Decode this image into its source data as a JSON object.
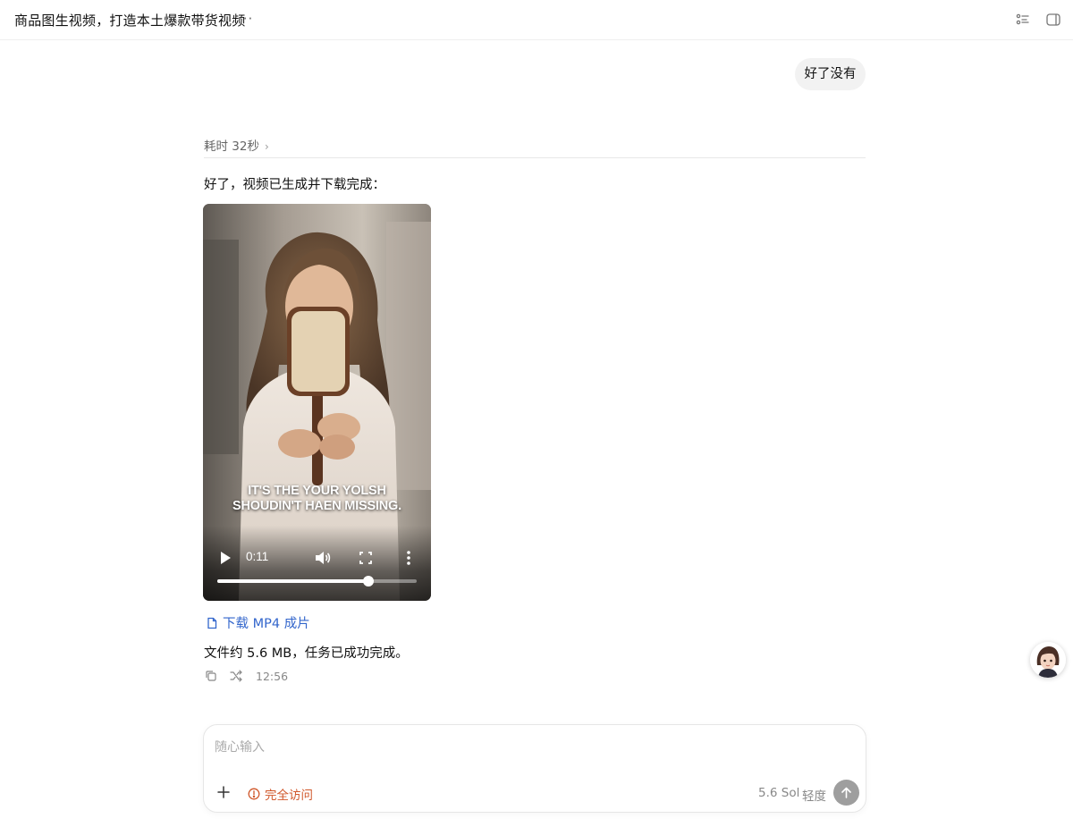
{
  "header": {
    "title": "商品图生视频，打造本土爆款带货视频",
    "more_label": "···",
    "list_icon": "checklist-icon",
    "panel_icon": "sidebar-panel-icon"
  },
  "conversation": {
    "user_message": "好了没有",
    "elapsed_label": "耗时 32秒",
    "reply_intro": "好了，视频已生成并下载完成：",
    "video": {
      "caption_line1": "IT'S THE YOUR YOLSH",
      "caption_line2": "SHOUDIN'T HAEN MISSING.",
      "current_time": "0:11",
      "progress": 0.76
    },
    "download_label": "下载 MP4 成片",
    "file_info": "文件约 5.6 MB，任务已成功完成。",
    "timestamp": "12:56"
  },
  "composer": {
    "placeholder": "随心输入",
    "access_label": "完全访问",
    "model_label": "5.6 Sol",
    "effort_label": "轻度"
  },
  "colors": {
    "link": "#3366cc",
    "warning": "#d0572a",
    "send_button": "#9e9e9e"
  }
}
